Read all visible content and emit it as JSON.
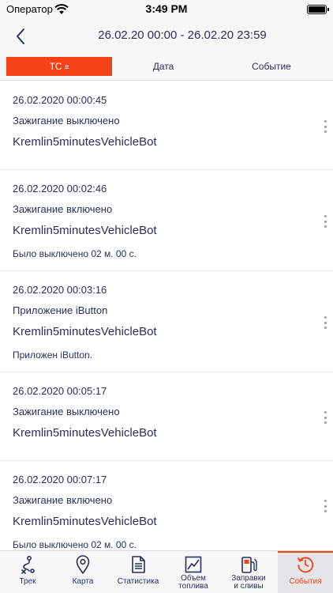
{
  "status": {
    "carrier": "Оператор",
    "time": "3:49 PM"
  },
  "nav": {
    "title": "26.02.20 00:00 - 26.02.20 23:59"
  },
  "segments": {
    "tc": "ТС",
    "date": "Дата",
    "event": "Событие",
    "sort_glyph": "≡"
  },
  "events": [
    {
      "timestamp": "26.02.2020 00:00:45",
      "event": "Зажигание выключено",
      "vehicle": "Kremlin5minutesVehicleBot",
      "detail": ""
    },
    {
      "timestamp": "26.02.2020 00:02:46",
      "event": "Зажигание включено",
      "vehicle": "Kremlin5minutesVehicleBot",
      "detail": "Было выключено 02 м. 00 с."
    },
    {
      "timestamp": "26.02.2020 00:03:16",
      "event": "Приложение iButton",
      "vehicle": "Kremlin5minutesVehicleBot",
      "detail": "Приложен iButton."
    },
    {
      "timestamp": "26.02.2020 00:05:17",
      "event": "Зажигание выключено",
      "vehicle": "Kremlin5minutesVehicleBot",
      "detail": ""
    },
    {
      "timestamp": "26.02.2020 00:07:17",
      "event": "Зажигание включено",
      "vehicle": "Kremlin5minutesVehicleBot",
      "detail": "Было выключено 02 м. 00 с."
    }
  ],
  "tabs": {
    "track": "Трек",
    "map": "Карта",
    "stats": "Статистика",
    "fuel": "Объем\nтоплива",
    "refuel": "Заправки\nи сливы",
    "events": "События"
  },
  "colors": {
    "accent": "#f44216",
    "text": "#2b2f5c",
    "bar": "#f7f7f8"
  }
}
